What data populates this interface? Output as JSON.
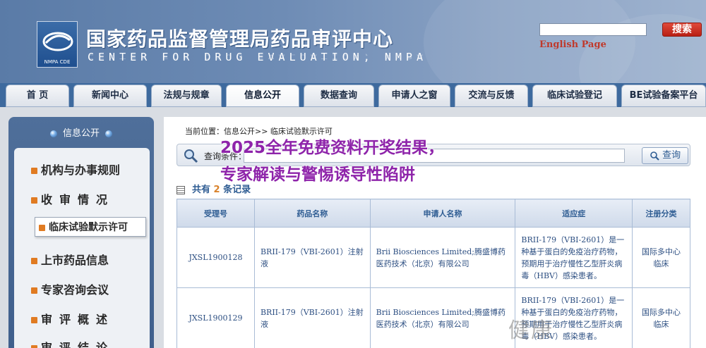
{
  "header": {
    "logo_caption": "NMPA CDE",
    "title_cn": "国家药品监督管理局药品审评中心",
    "title_en": "CENTER FOR DRUG EVALUATION, NMPA",
    "search_button": "搜索",
    "english_link": "English Page"
  },
  "nav": {
    "tabs": [
      "首 页",
      "新闻中心",
      "法规与规章",
      "信息公开",
      "数据查询",
      "申请人之窗",
      "交流与反馈",
      "临床试验登记",
      "BE试验备案平台"
    ],
    "active": "信息公开"
  },
  "sidebar": {
    "heading": "信息公开",
    "items": [
      "机构与办事规则",
      "收审情况",
      "临床试验默示许可",
      "上市药品信息",
      "专家咨询会议",
      "审评概述",
      "审评结论"
    ]
  },
  "main": {
    "breadcrumb": "当前位置：信息公开>> 临床试验默示许可",
    "query_label": "查询条件：",
    "query_button": "查询",
    "count_prefix": "共有",
    "count_value": "2",
    "count_suffix": "条记录",
    "table": {
      "headers": [
        "受理号",
        "药品名称",
        "申请人名称",
        "适应症",
        "注册分类"
      ],
      "rows": [
        [
          "JXSL1900128",
          "BRII-179（VBI-2601）注射液",
          "Brii Biosciences Limited;腾盛博药医药技术（北京）有限公司",
          "BRII-179（VBI-2601）是一种基于蛋白的免疫治疗药物，预期用于治疗慢性乙型肝炎病毒（HBV）感染患者。",
          "国际多中心临床"
        ],
        [
          "JXSL1900129",
          "BRII-179（VBI-2601）注射液",
          "Brii Biosciences Limited;腾盛博药医药技术（北京）有限公司",
          "BRII-179（VBI-2601）是一种基于蛋白的免疫治疗药物，预期用于治疗慢性乙型肝炎病毒（HBV）感染患者。",
          "国际多中心临床"
        ]
      ]
    }
  },
  "overlay": {
    "line1": "2025全年免费资料开奖结果，",
    "line2": "专家解读与警惕诱导性陷阱",
    "watermark": "健康"
  },
  "colors": {
    "header_bg": "#6e8cb5",
    "nav_bg": "#3e6a9e",
    "accent_orange": "#d9822b",
    "overlay_purple": "#8e24aa",
    "link_blue": "#2f5d93"
  }
}
